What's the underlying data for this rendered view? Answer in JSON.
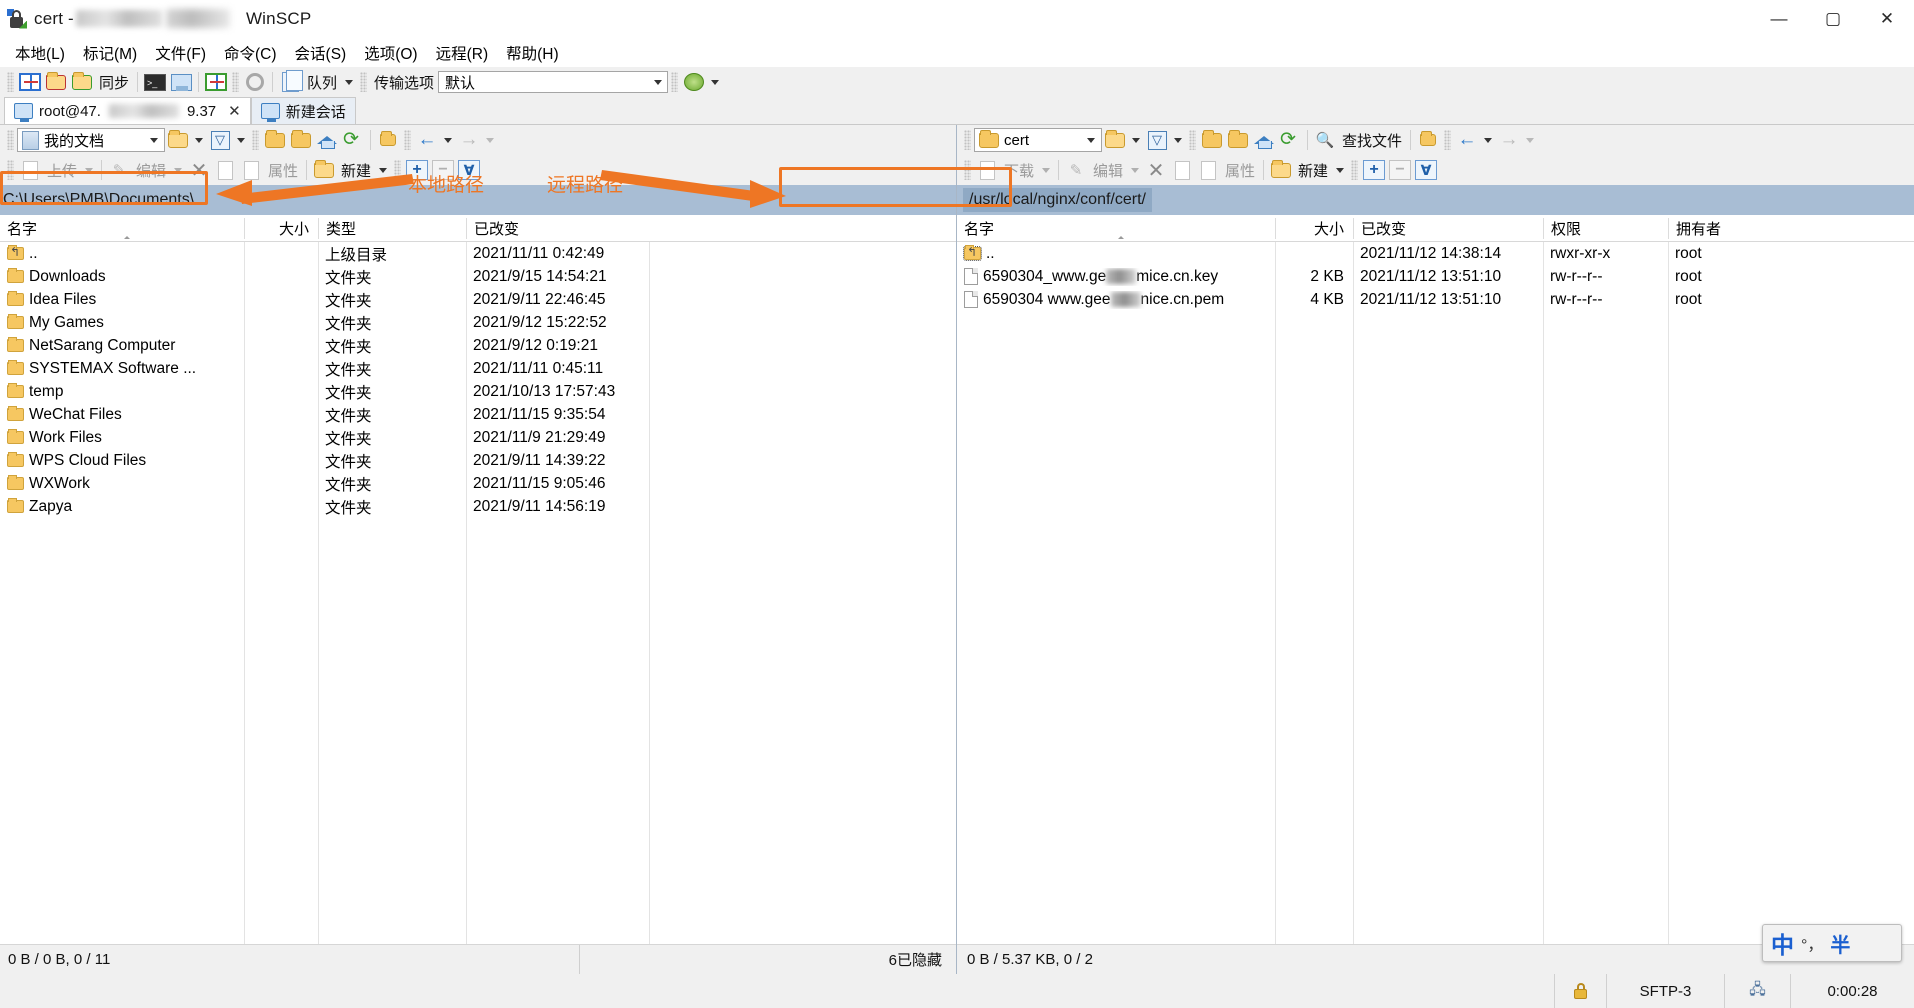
{
  "window": {
    "title_prefix": "cert - ",
    "title_suffix": "WinSCP",
    "minimize": "—",
    "maximize": "▢",
    "close": "✕"
  },
  "menu": [
    {
      "label": "本地(L)"
    },
    {
      "label": "标记(M)"
    },
    {
      "label": "文件(F)"
    },
    {
      "label": "命令(C)"
    },
    {
      "label": "会话(S)"
    },
    {
      "label": "选项(O)"
    },
    {
      "label": "远程(R)"
    },
    {
      "label": "帮助(H)"
    }
  ],
  "toolbar": {
    "sync_label": "同步",
    "queue_label": "队列",
    "transfer_label": "传输选项",
    "transfer_value": "默认",
    "icons": {
      "sync_browse": "sync-browsing-icon",
      "sync_up": "synchronize-up-icon",
      "sync_down": "synchronize-down-icon",
      "console": "console-icon",
      "putty": "open-terminal-icon",
      "refresh_session": "refresh-session-icon",
      "preferences": "gear-icon",
      "queue": "queue-icon",
      "queue_dropdown": "chevron-down-icon",
      "transfer_dropdown": "chevron-down-icon",
      "help": "help-icon",
      "help_dropdown": "chevron-down-icon"
    }
  },
  "session_tabs": {
    "active": {
      "label_prefix": "root@47.",
      "label_suffix": "9.37",
      "close": "✕"
    },
    "new": {
      "label": "新建会话"
    }
  },
  "local": {
    "path_combo": "我的文档",
    "actions": {
      "upload": "上传",
      "edit": "编辑",
      "delete_icon": "delete-icon",
      "rename_icon": "rename-icon",
      "duplicate_icon": "duplicate-icon",
      "properties": "属性",
      "new": "新建"
    },
    "path": "C:\\Users\\PMB\\Documents\\",
    "columns": [
      {
        "label": "名字",
        "align": "left"
      },
      {
        "label": "大小",
        "align": "right"
      },
      {
        "label": "类型",
        "align": "left"
      },
      {
        "label": "已改变",
        "align": "left"
      }
    ],
    "rows": [
      {
        "name": "..",
        "icon": "parent-folder-icon",
        "size": "",
        "type": "上级目录",
        "changed": "2021/11/11  0:42:49"
      },
      {
        "name": "Downloads",
        "icon": "folder-icon",
        "size": "",
        "type": "文件夹",
        "changed": "2021/9/15  14:54:21"
      },
      {
        "name": "Idea Files",
        "icon": "folder-icon",
        "size": "",
        "type": "文件夹",
        "changed": "2021/9/11  22:46:45"
      },
      {
        "name": "My Games",
        "icon": "folder-icon",
        "size": "",
        "type": "文件夹",
        "changed": "2021/9/12  15:22:52"
      },
      {
        "name": "NetSarang Computer",
        "icon": "folder-icon",
        "size": "",
        "type": "文件夹",
        "changed": "2021/9/12  0:19:21"
      },
      {
        "name": "SYSTEMAX Software ...",
        "icon": "folder-icon",
        "size": "",
        "type": "文件夹",
        "changed": "2021/11/11  0:45:11"
      },
      {
        "name": "temp",
        "icon": "folder-icon",
        "size": "",
        "type": "文件夹",
        "changed": "2021/10/13  17:57:43"
      },
      {
        "name": "WeChat Files",
        "icon": "folder-icon",
        "size": "",
        "type": "文件夹",
        "changed": "2021/11/15  9:35:54"
      },
      {
        "name": "Work Files",
        "icon": "folder-icon",
        "size": "",
        "type": "文件夹",
        "changed": "2021/11/9  21:29:49"
      },
      {
        "name": "WPS Cloud Files",
        "icon": "folder-icon",
        "size": "",
        "type": "文件夹",
        "changed": "2021/9/11  14:39:22"
      },
      {
        "name": "WXWork",
        "icon": "folder-icon",
        "size": "",
        "type": "文件夹",
        "changed": "2021/11/15  9:05:46"
      },
      {
        "name": "Zapya",
        "icon": "folder-icon",
        "size": "",
        "type": "文件夹",
        "changed": "2021/9/11  14:56:19"
      }
    ],
    "status": "0 B / 0 B,  0 / 11",
    "hidden": "6已隐藏"
  },
  "remote": {
    "path_combo": "cert",
    "actions": {
      "download": "下载",
      "edit": "编辑",
      "delete_icon": "delete-icon",
      "rename_icon": "rename-icon",
      "duplicate_icon": "duplicate-icon",
      "properties": "属性",
      "new": "新建",
      "find_files": "查找文件"
    },
    "path": "/usr/local/nginx/conf/cert/",
    "columns": [
      {
        "label": "名字",
        "align": "left"
      },
      {
        "label": "大小",
        "align": "right"
      },
      {
        "label": "已改变",
        "align": "left"
      },
      {
        "label": "权限",
        "align": "left"
      },
      {
        "label": "拥有者",
        "align": "left"
      }
    ],
    "rows": [
      {
        "name": "..",
        "icon": "parent-folder-icon",
        "size": "",
        "changed": "2021/11/12  14:38:14",
        "rights": "rwxr-xr-x",
        "owner": "root"
      },
      {
        "name_a": "6590304_www.ge",
        "name_b": "mice.cn.key",
        "icon": "file-icon",
        "size": "2 KB",
        "changed": "2021/11/12  13:51:10",
        "rights": "rw-r--r--",
        "owner": "root"
      },
      {
        "name_a": "6590304 www.gee",
        "name_b": "nice.cn.pem",
        "icon": "file-icon",
        "size": "4 KB",
        "changed": "2021/11/12  13:51:10",
        "rights": "rw-r--r--",
        "owner": "root"
      }
    ],
    "status": "0 B / 5.37 KB,  0 / 2"
  },
  "annotations": {
    "local_label": "本地路径",
    "remote_label": "远程路径",
    "color": "#ee7624"
  },
  "footer": {
    "protocol": "SFTP-3",
    "timer": "0:00:28",
    "lock_icon": "lock-icon",
    "network_icon": "network-icon"
  },
  "ime": {
    "mode": "中",
    "symbols": "°，",
    "width_mode": "半"
  }
}
